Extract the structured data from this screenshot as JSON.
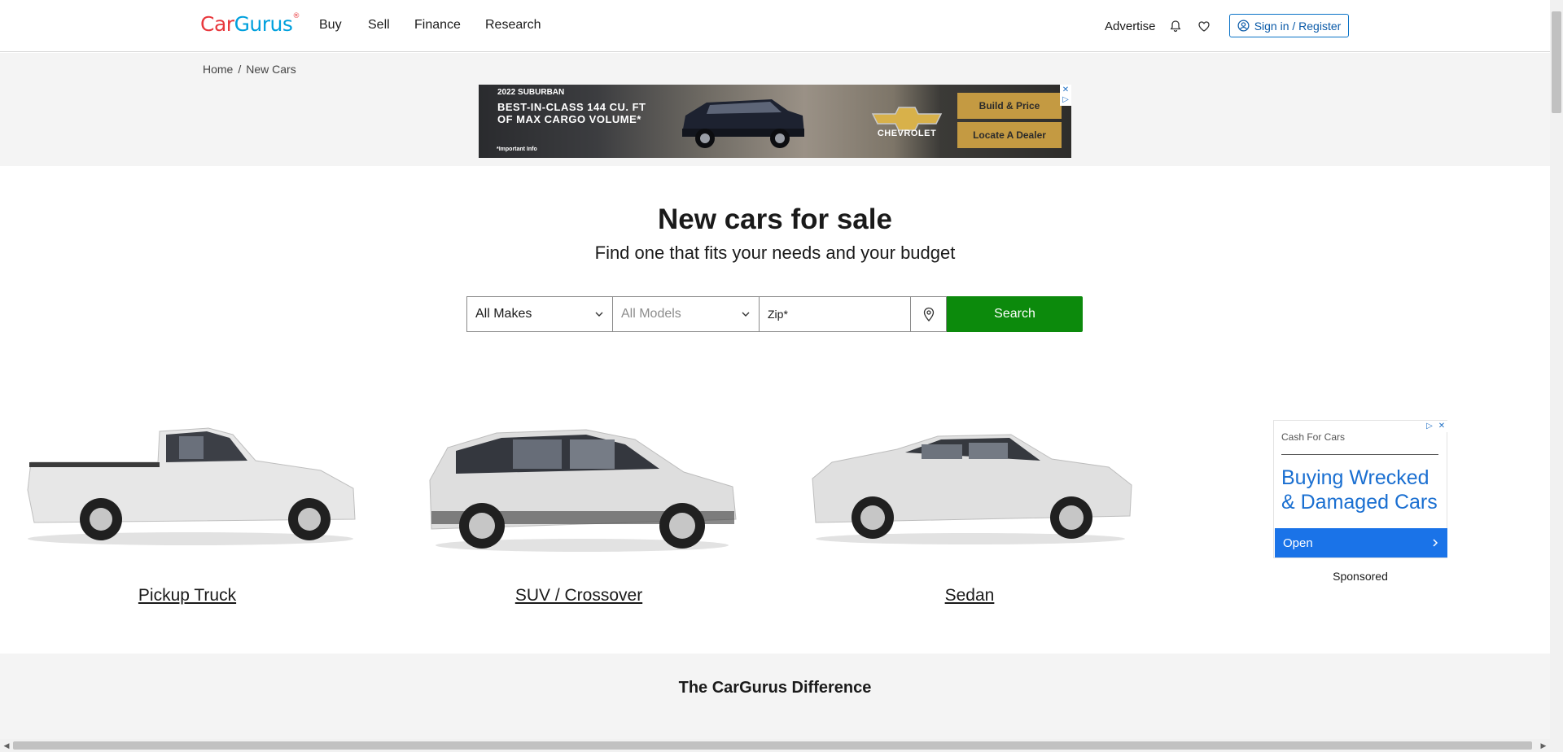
{
  "header": {
    "logo_part1": "Car",
    "logo_part2": "Gurus",
    "logo_mark": "®",
    "nav": [
      "Buy",
      "Sell",
      "Finance",
      "Research"
    ],
    "advertise": "Advertise",
    "sign_in": "Sign in / Register"
  },
  "breadcrumb": {
    "items": [
      "Home",
      "New Cars"
    ],
    "separator": "/"
  },
  "banner_ad": {
    "line1": "2022 SUBURBAN",
    "line2": "BEST-IN-CLASS 144 CU. FT",
    "line3": "OF MAX CARGO VOLUME*",
    "footnote": "*Important Info",
    "brand": "CHEVROLET",
    "btn1": "Build & Price",
    "btn2": "Locate A Dealer",
    "close": "✕",
    "info": "▷"
  },
  "hero": {
    "title": "New cars for sale",
    "subtitle": "Find one that fits your needs and your budget"
  },
  "search": {
    "make": "All Makes",
    "model": "All Models",
    "zip_placeholder": "Zip*",
    "button": "Search"
  },
  "categories": [
    {
      "label": "Pickup Truck",
      "icon": "pickup-truck-image"
    },
    {
      "label": "SUV / Crossover",
      "icon": "suv-image"
    },
    {
      "label": "Sedan",
      "icon": "sedan-image"
    }
  ],
  "side_ad": {
    "source": "Cash For Cars",
    "headline": "Buying Wrecked & Damaged Cars",
    "open": "Open",
    "sponsored": "Sponsored"
  },
  "bottom": {
    "title": "The CarGurus Difference"
  },
  "colors": {
    "search_button": "#0c8a0c",
    "link_blue": "#0a5aa8",
    "ad_button_gold": "#c49a42"
  }
}
